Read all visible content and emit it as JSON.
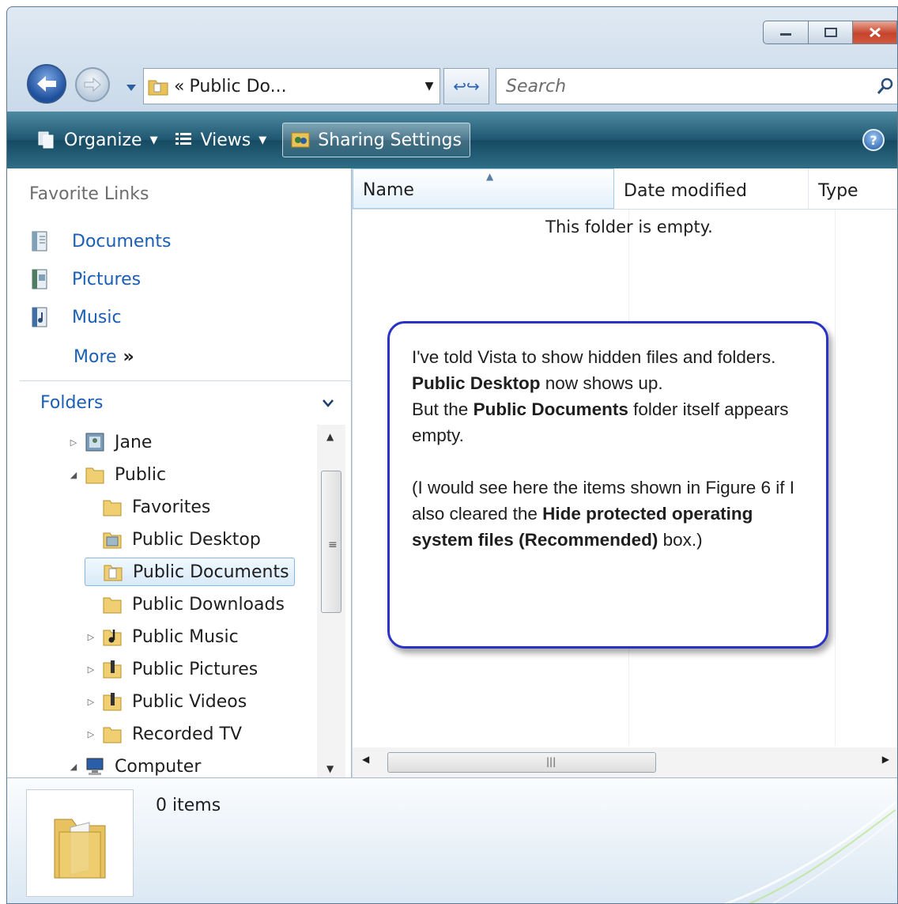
{
  "titlebar": {
    "min_icon": "minimize-icon",
    "max_icon": "maximize-icon",
    "close_icon": "close-icon"
  },
  "nav": {
    "address_chevron": "«",
    "address_text": "Public Do...",
    "search_placeholder": "Search"
  },
  "toolbar": {
    "organize": "Organize",
    "views": "Views",
    "sharing": "Sharing Settings"
  },
  "favorites": {
    "heading": "Favorite Links",
    "items": [
      {
        "label": "Documents",
        "icon": "documents-icon"
      },
      {
        "label": "Pictures",
        "icon": "pictures-icon"
      },
      {
        "label": "Music",
        "icon": "music-icon"
      }
    ],
    "more": "More",
    "more_glyph": "»"
  },
  "folders": {
    "heading": "Folders",
    "tree": [
      {
        "label": "Jane",
        "level": 0,
        "expander": "▷",
        "icon": "user-folder-icon"
      },
      {
        "label": "Public",
        "level": 0,
        "expander": "◢",
        "icon": "folder-icon"
      },
      {
        "label": "Favorites",
        "level": 1,
        "expander": "",
        "icon": "folder-icon"
      },
      {
        "label": "Public Desktop",
        "level": 1,
        "expander": "",
        "icon": "desktop-folder-icon"
      },
      {
        "label": "Public Documents",
        "level": 1,
        "expander": "",
        "icon": "documents-folder-icon",
        "selected": true
      },
      {
        "label": "Public Downloads",
        "level": 1,
        "expander": "",
        "icon": "folder-icon"
      },
      {
        "label": "Public Music",
        "level": 1,
        "expander": "▷",
        "icon": "music-folder-icon"
      },
      {
        "label": "Public Pictures",
        "level": 1,
        "expander": "▷",
        "icon": "pictures-folder-icon"
      },
      {
        "label": "Public Videos",
        "level": 1,
        "expander": "▷",
        "icon": "videos-folder-icon"
      },
      {
        "label": "Recorded TV",
        "level": 1,
        "expander": "▷",
        "icon": "folder-icon"
      },
      {
        "label": "Computer",
        "level": 0,
        "expander": "◢",
        "icon": "computer-icon"
      }
    ]
  },
  "columns": {
    "name": "Name",
    "date": "Date modified",
    "type": "Type"
  },
  "empty_message": "This folder is empty.",
  "callout": {
    "line1": "I've told Vista to show hidden files and folders.",
    "p2_bold": "Public Desktop",
    "p2_rest": " now shows up.",
    "p3_a": "But the ",
    "p3_bold": "Public Documents",
    "p3_b": " folder itself appears empty.",
    "p4_a": "(I would see here the items shown in Figure 6 if I also cleared the ",
    "p4_bold": "Hide protected operating system files (Recommended)",
    "p4_b": " box.)"
  },
  "details": {
    "count": "0 items"
  },
  "colors": {
    "accent": "#1a5fb4",
    "toolbar": "#1f5570",
    "callout_border": "#2a32c8"
  }
}
